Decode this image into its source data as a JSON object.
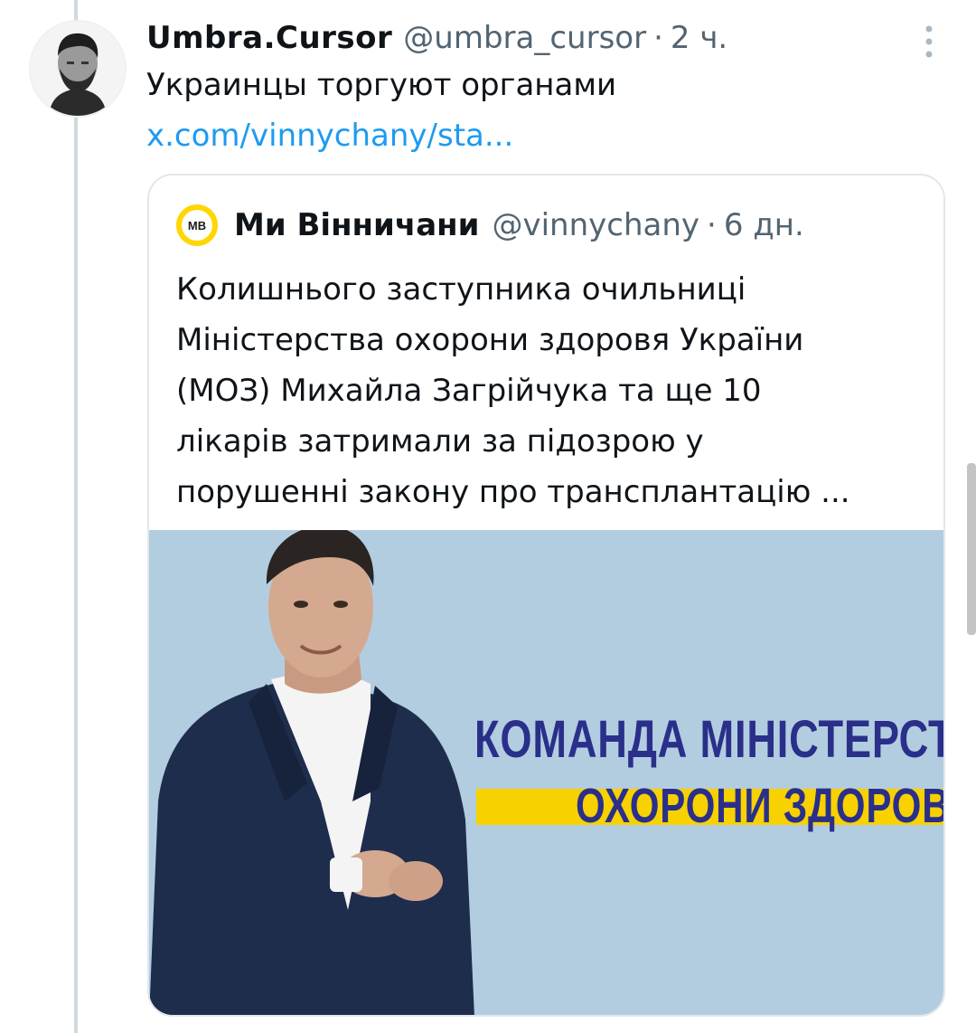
{
  "tweet": {
    "author_name": "Umbra.Cursor",
    "author_handle": "@umbra_cursor",
    "separator": "·",
    "time": "2 ч.",
    "text": "Украинцы торгуют органами",
    "link": "x.com/vinnychany/sta..."
  },
  "quote": {
    "avatar_text": "МВ",
    "name": "Ми Вінничани",
    "handle": "@vinnychany",
    "separator": "·",
    "time": "6 дн.",
    "text_lines": [
      "Колишнього заступника очильниці",
      "Міністерства охорони здоровя України",
      "(МОЗ) Михайла Загрійчука та ще 10",
      "лікарів затримали за підозрою у",
      "порушенні закону про трансплантацію ..."
    ],
    "image": {
      "banner_line1": "КОМАНДА МІНІСТЕРСТВА",
      "banner_line2": "ОХОРОНИ ЗДОРОВ'Я"
    }
  },
  "icons": {
    "more": "more-vertical-icon"
  },
  "colors": {
    "link": "#1d9bf0",
    "secondary_text": "#536471",
    "banner_text": "#2a2f8a",
    "banner_highlight": "#f7d100",
    "image_background": "#b3cde0"
  }
}
